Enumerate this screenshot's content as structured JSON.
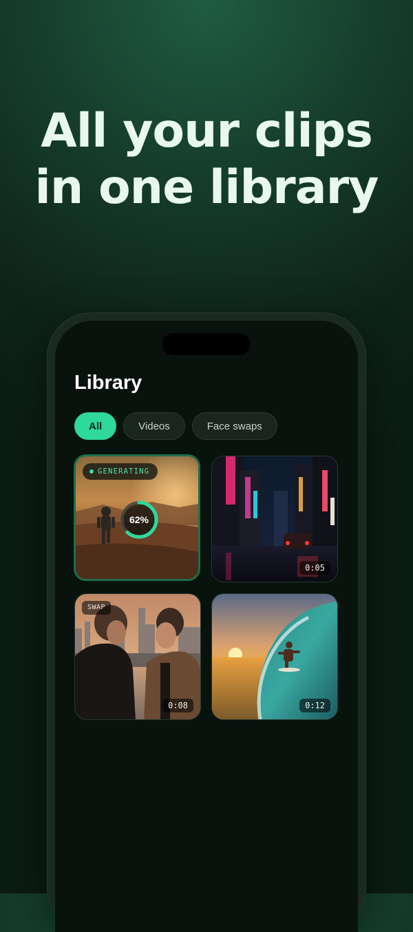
{
  "headline": {
    "line1": "All your clips",
    "line2": "in one library"
  },
  "screen": {
    "title": "Library",
    "tabs": [
      {
        "label": "All",
        "active": true
      },
      {
        "label": "Videos",
        "active": false
      },
      {
        "label": "Face swaps",
        "active": false
      }
    ],
    "clips": [
      {
        "status": "GENERATING",
        "progress_label": "62%",
        "progress": 0.62,
        "scene": "astronaut-desert"
      },
      {
        "duration": "0:05",
        "scene": "neon-city-street"
      },
      {
        "badge": "SWAP",
        "duration": "0:08",
        "scene": "two-men-rooftop"
      },
      {
        "duration": "0:12",
        "scene": "surfer-wave-sunset"
      }
    ]
  },
  "colors": {
    "accent": "#2fd89b",
    "background": "#0e2418",
    "screen": "#08130e"
  }
}
